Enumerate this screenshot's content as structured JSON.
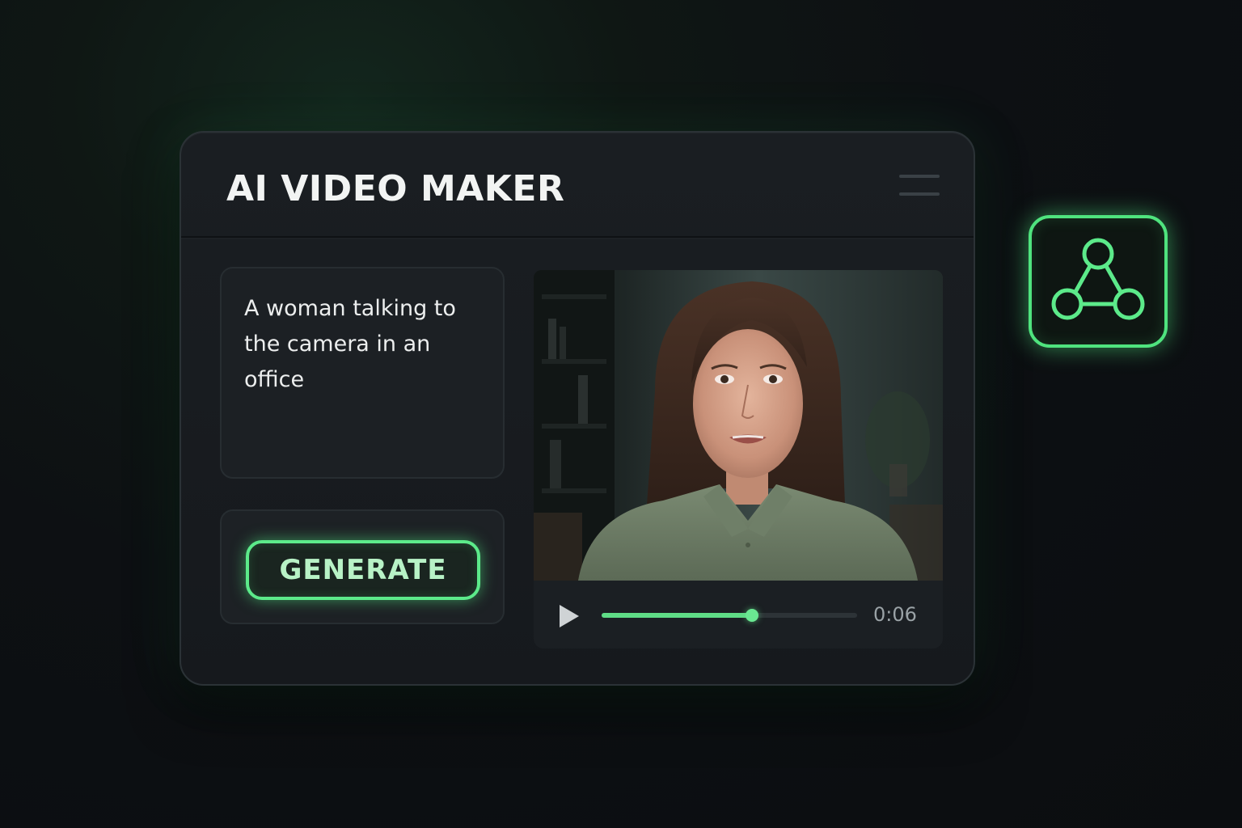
{
  "app": {
    "title": "AI VIDEO MAKER"
  },
  "header": {
    "menu_icon": "hamburger-menu-icon"
  },
  "prompt": {
    "text": "A woman talking to the camera in an office"
  },
  "generate": {
    "label": "GENERATE"
  },
  "player": {
    "preview_subject": "woman talking to camera in office",
    "play_icon": "play-icon",
    "progress_fraction": 0.59,
    "time": "0:06"
  },
  "side_badge": {
    "icon": "network-share-icon"
  },
  "colors": {
    "accent": "#5cea8a",
    "background": "#0d1013",
    "panel": "#1a1e22"
  }
}
